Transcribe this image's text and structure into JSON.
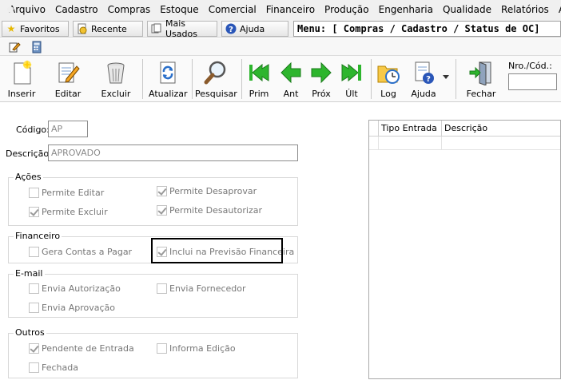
{
  "menubar": {
    "items": [
      "Arquivo",
      "Cadastro",
      "Compras",
      "Estoque",
      "Comercial",
      "Financeiro",
      "Produção",
      "Engenharia",
      "Qualidade",
      "Relatórios",
      "Ajuda"
    ]
  },
  "quickbar": {
    "favoritos": "Favoritos",
    "recente": "Recente",
    "mais_usados": "Mais Usados",
    "ajuda": "Ajuda",
    "menu_path": "Menu: [ Compras / Cadastro / Status de OC]"
  },
  "toolbar": {
    "inserir": "Inserir",
    "editar": "Editar",
    "excluir": "Excluir",
    "atualizar": "Atualizar",
    "pesquisar": "Pesquisar",
    "prim": "Prim",
    "ant": "Ant",
    "prox": "Próx",
    "ult": "Últ",
    "log": "Log",
    "ajuda": "Ajuda",
    "fechar": "Fechar",
    "nro_label": "Nro./Cód.:",
    "nro_value": ""
  },
  "form": {
    "codigo_label": "Código:",
    "codigo_value": "AP",
    "descricao_label": "Descrição:",
    "descricao_value": "APROVADO",
    "acoes": {
      "title": "Ações",
      "permite_editar": "Permite Editar",
      "permite_desaprovar": "Permite Desaprovar",
      "permite_excluir": "Permite Excluir",
      "permite_desautorizar": "Permite Desautorizar"
    },
    "financeiro": {
      "title": "Financeiro",
      "gera_contas": "Gera Contas a Pagar",
      "inclui_previsao": "Inclui na Previsão Financeira"
    },
    "email": {
      "title": "E-mail",
      "envia_autorizacao": "Envia Autorização",
      "envia_fornecedor": "Envia Fornecedor",
      "envia_aprovacao": "Envia Aprovação"
    },
    "outros": {
      "title": "Outros",
      "pendente_entrada": "Pendente de Entrada",
      "informa_edicao": "Informa Edição",
      "fechada": "Fechada"
    }
  },
  "grid": {
    "columns": [
      "Tipo Entrada",
      "Descrição"
    ]
  },
  "colors": {
    "nav_green": "#2db52d",
    "accent_blue": "#2a6fc9"
  }
}
